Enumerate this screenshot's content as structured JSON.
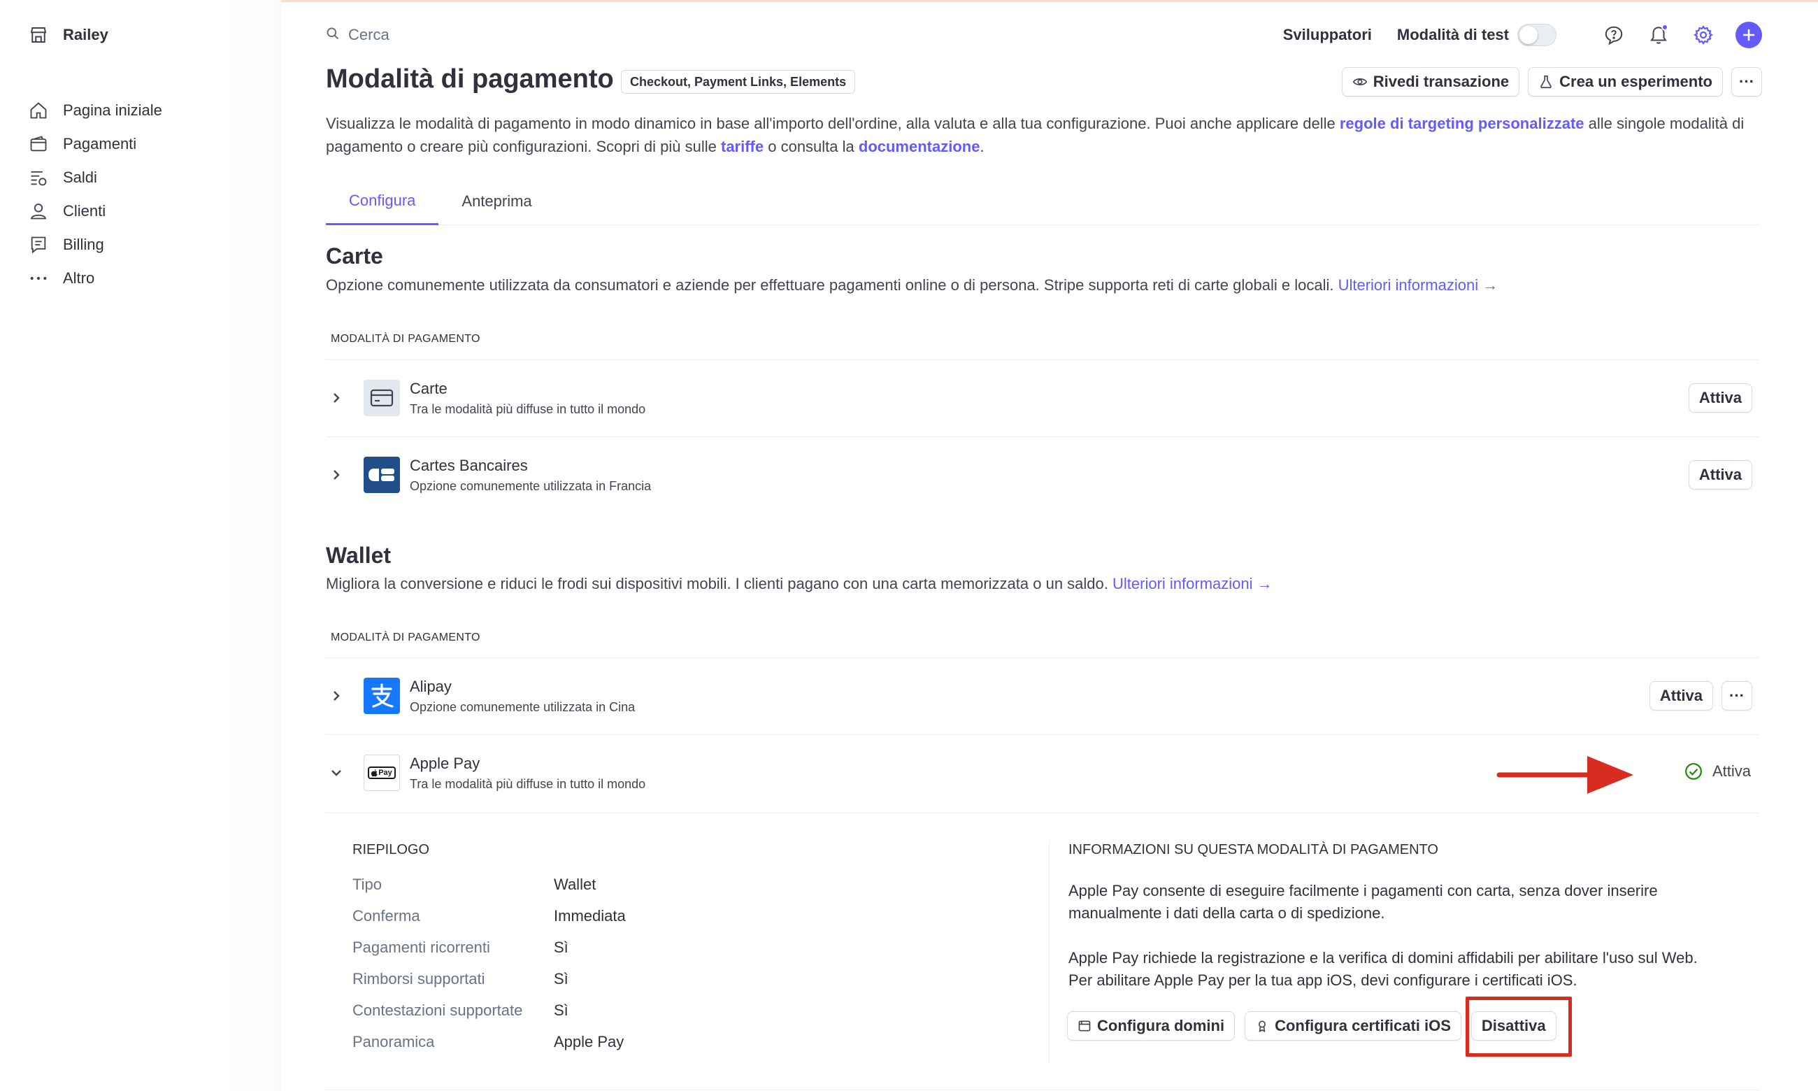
{
  "account": {
    "name": "Railey"
  },
  "sidebar": {
    "items": [
      {
        "label": "Pagina iniziale",
        "icon": "home-icon"
      },
      {
        "label": "Pagamenti",
        "icon": "wallet-icon"
      },
      {
        "label": "Saldi",
        "icon": "balances-icon"
      },
      {
        "label": "Clienti",
        "icon": "user-icon"
      },
      {
        "label": "Billing",
        "icon": "billing-icon"
      },
      {
        "label": "Altro",
        "icon": "more-icon"
      }
    ]
  },
  "topbar": {
    "search_placeholder": "Cerca",
    "developers": "Sviluppatori",
    "test_mode": "Modalità di test",
    "test_mode_on": false
  },
  "header": {
    "title": "Modalità di pagamento",
    "badge": "Checkout, Payment Links, Elements",
    "review_button": "Rivedi transazione",
    "experiment_button": "Crea un esperimento",
    "more_button": "···",
    "desc_part1": "Visualizza le modalità di pagamento in modo dinamico in base all'importo dell'ordine, alla valuta e alla tua configurazione. Puoi anche applicare delle ",
    "desc_link1": "regole di targeting personalizzate",
    "desc_part2": " alle singole modalità di pagamento o creare più configurazioni. Scopri di più sulle ",
    "desc_link2": "tariffe",
    "desc_part3": " o consulta la ",
    "desc_link3": "documentazione",
    "desc_part4": "."
  },
  "tabs": [
    {
      "label": "Configura",
      "active": true
    },
    {
      "label": "Anteprima",
      "active": false
    }
  ],
  "cards_section": {
    "title": "Carte",
    "desc": "Opzione comunemente utilizzata da consumatori e aziende per effettuare pagamenti online o di persona. Stripe supporta reti di carte globali e locali.",
    "learn_more": "Ulteriori informazioni →",
    "column_header": "MODALITÀ DI PAGAMENTO",
    "methods": [
      {
        "name": "Carte",
        "sub": "Tra le modalità più diffuse in tutto il mondo",
        "action": "Attiva"
      },
      {
        "name": "Cartes Bancaires",
        "sub": "Opzione comunemente utilizzata in Francia",
        "action": "Attiva"
      }
    ]
  },
  "wallet_section": {
    "title": "Wallet",
    "desc": "Migliora la conversione e riduci le frodi sui dispositivi mobili. I clienti pagano con una carta memorizzata o un saldo.",
    "learn_more": "Ulteriori informazioni →",
    "column_header": "MODALITÀ DI PAGAMENTO",
    "methods": [
      {
        "name": "Alipay",
        "sub": "Opzione comunemente utilizzata in Cina",
        "action": "Attiva",
        "more": "···"
      },
      {
        "name": "Apple Pay",
        "sub": "Tra le modalità più diffuse in tutto il mondo",
        "status": "Attiva",
        "logo_text": "Pay"
      }
    ]
  },
  "apple_pay_details": {
    "summary_heading": "RIEPILOGO",
    "summary": [
      {
        "key": "Tipo",
        "value": "Wallet",
        "is_link": true
      },
      {
        "key": "Conferma",
        "value": "Immediata",
        "is_link": false
      },
      {
        "key": "Pagamenti ricorrenti",
        "value": "Sì",
        "is_link": false
      },
      {
        "key": "Rimborsi supportati",
        "value": "Sì",
        "is_link": false
      },
      {
        "key": "Contestazioni supportate",
        "value": "Sì",
        "is_link": false
      },
      {
        "key": "Panoramica",
        "value": "Apple Pay",
        "is_link": true
      }
    ],
    "info_heading": "INFORMAZIONI SU QUESTA MODALITÀ DI PAGAMENTO",
    "info_p1": "Apple Pay consente di eseguire facilmente i pagamenti con carta, senza dover inserire manualmente i dati della carta o di spedizione.",
    "info_p2": "Apple Pay richiede la registrazione e la verifica di domini affidabili per abilitare l'uso sul Web. Per abilitare Apple Pay per la tua app iOS, devi configurare i certificati iOS.",
    "btn_domains": "Configura domini",
    "btn_ios": "Configura certificati iOS",
    "btn_disable": "Disattiva"
  },
  "colors": {
    "accent": "#635bff",
    "annotation_red": "#d92c20",
    "success_green": "#228403"
  }
}
